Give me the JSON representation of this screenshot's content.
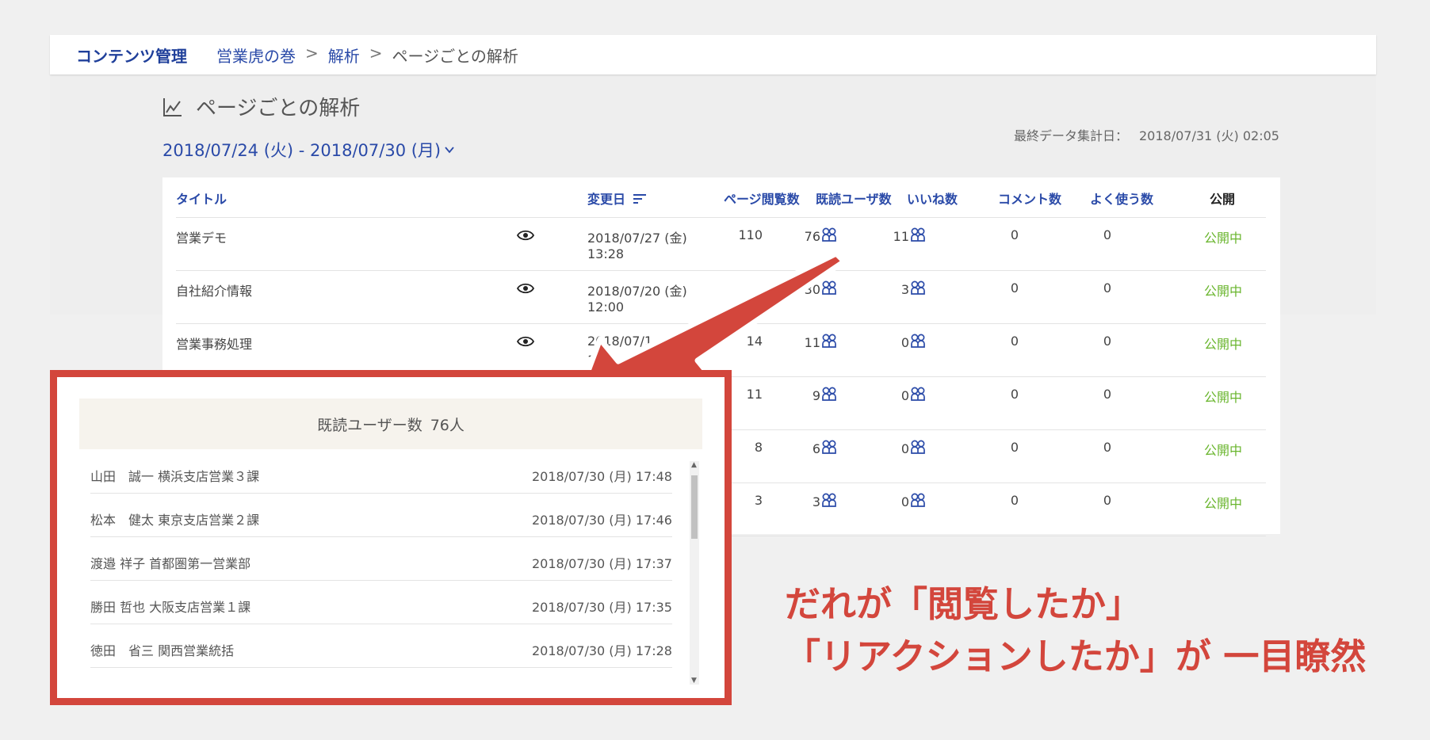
{
  "header": {
    "brand": "コンテンツ管理",
    "breadcrumbs": [
      "営業虎の巻",
      "解析",
      "ページごとの解析"
    ],
    "separator": ">"
  },
  "page": {
    "title": "ページごとの解析",
    "date_range": "2018/07/24 (火) - 2018/07/30 (月)",
    "last_update_label": "最終データ集計日：",
    "last_update_value": "2018/07/31 (火) 02:05"
  },
  "table": {
    "columns": {
      "title": "タイトル",
      "modified": "変更日",
      "views": "ページ閲覧数",
      "readers": "既読ユーザ数",
      "likes": "いいね数",
      "comments": "コメント数",
      "favorites": "よく使う数",
      "publish": "公開"
    },
    "rows": [
      {
        "title": "営業デモ",
        "date": "2018/07/27 (金)",
        "time": "13:28",
        "views": "110",
        "readers": "76",
        "likes": "11",
        "comments": "0",
        "favorites": "0",
        "status": "公開中"
      },
      {
        "title": "自社紹介情報",
        "date": "2018/07/20 (金)",
        "time": "12:00",
        "views": "",
        "readers": "30",
        "likes": "3",
        "comments": "0",
        "favorites": "0",
        "status": "公開中"
      },
      {
        "title": "営業事務処理",
        "date": "2018/07/1",
        "time": "1",
        "views": "14",
        "readers": "11",
        "likes": "0",
        "comments": "0",
        "favorites": "0",
        "status": "公開中"
      },
      {
        "title": "",
        "date": "",
        "time": "",
        "views": "11",
        "readers": "9",
        "likes": "0",
        "comments": "0",
        "favorites": "0",
        "status": "公開中"
      },
      {
        "title": "",
        "date": "",
        "time": "",
        "views": "8",
        "readers": "6",
        "likes": "0",
        "comments": "0",
        "favorites": "0",
        "status": "公開中"
      },
      {
        "title": "",
        "date": "",
        "time": "",
        "views": "3",
        "readers": "3",
        "likes": "0",
        "comments": "0",
        "favorites": "0",
        "status": "公開中"
      }
    ]
  },
  "popup": {
    "header_label": "既読ユーザー数",
    "header_count": "76人",
    "items": [
      {
        "name": "山田　誠一 横浜支店営業３課",
        "time": "2018/07/30 (月) 17:48"
      },
      {
        "name": "松本　健太 東京支店営業２課",
        "time": "2018/07/30 (月) 17:46"
      },
      {
        "name": "渡邉 祥子 首都圏第一営業部",
        "time": "2018/07/30 (月) 17:37"
      },
      {
        "name": "勝田 哲也 大阪支店営業１課",
        "time": "2018/07/30 (月) 17:35"
      },
      {
        "name": "徳田　省三 関西営業統括",
        "time": "2018/07/30 (月) 17:28"
      }
    ]
  },
  "callout": {
    "line1": "だれが「閲覧したか」",
    "line2": "「リアクションしたか」が 一目瞭然"
  },
  "colors": {
    "brand_blue": "#1f3f9a",
    "link_blue": "#2a4aa8",
    "publish_green": "#69b52d",
    "callout_red": "#d3463c"
  },
  "icons": {
    "heading": "line-chart-icon",
    "view": "eye-icon",
    "users": "users-icon",
    "sort": "sort-lines-icon",
    "dropdown": "chevron-down-icon"
  }
}
